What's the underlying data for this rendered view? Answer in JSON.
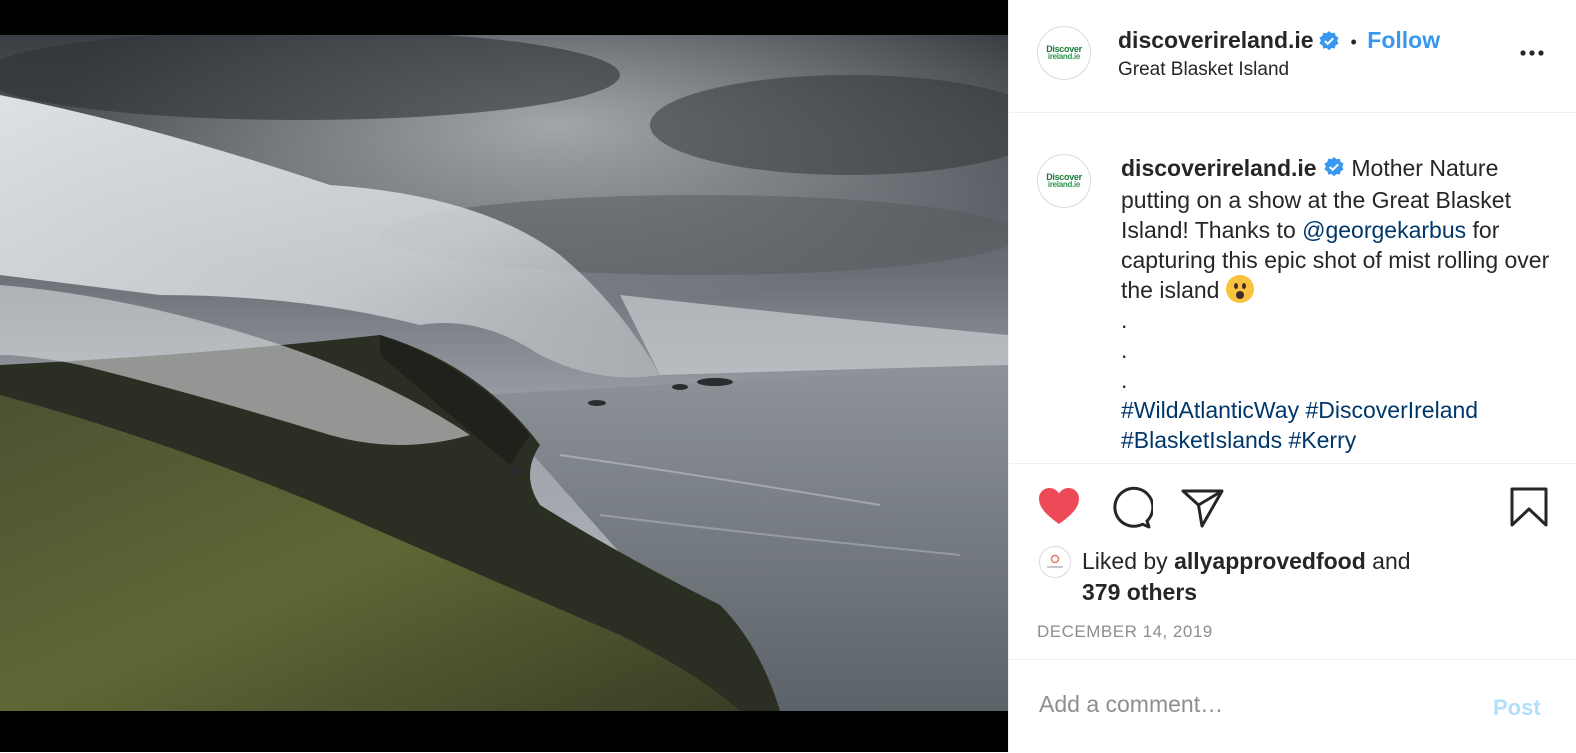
{
  "header": {
    "avatar_line1": "Discover",
    "avatar_line2": "ireland.ie",
    "username": "discoverireland.ie",
    "separator": "•",
    "follow_label": "Follow",
    "location": "Great Blasket Island"
  },
  "post_image": {
    "icon": "photo-of-mist-rolling-over-cliffs"
  },
  "caption": {
    "username": "discoverireland.ie",
    "text_part1": "Mother Nature putting on a show at the Great Blasket Island! Thanks to ",
    "mention": "@georgekarbus",
    "text_part2": " for capturing this epic shot of mist rolling over the island ",
    "dot1": ".",
    "dot2": ".",
    "dot3": ".",
    "hashtags": [
      "#WildAtlanticWay",
      "#DiscoverIreland",
      "#BlasketIslands",
      "#Kerry"
    ]
  },
  "actions": {
    "like_icon": "heart-filled-icon",
    "comment_icon": "comment-icon",
    "share_icon": "share-icon",
    "save_icon": "bookmark-icon",
    "like_color": "#ed4956"
  },
  "likes": {
    "prefix": "Liked by ",
    "user": "allyapprovedfood",
    "conjunction": " and",
    "others": "379 others"
  },
  "date": "DECEMBER 14, 2019",
  "comment": {
    "placeholder": "Add a comment…",
    "post_label": "Post"
  },
  "colors": {
    "accent": "#3897f0",
    "link": "#00376b",
    "verified": "#3897f0",
    "post_disabled": "#b2dffc"
  }
}
